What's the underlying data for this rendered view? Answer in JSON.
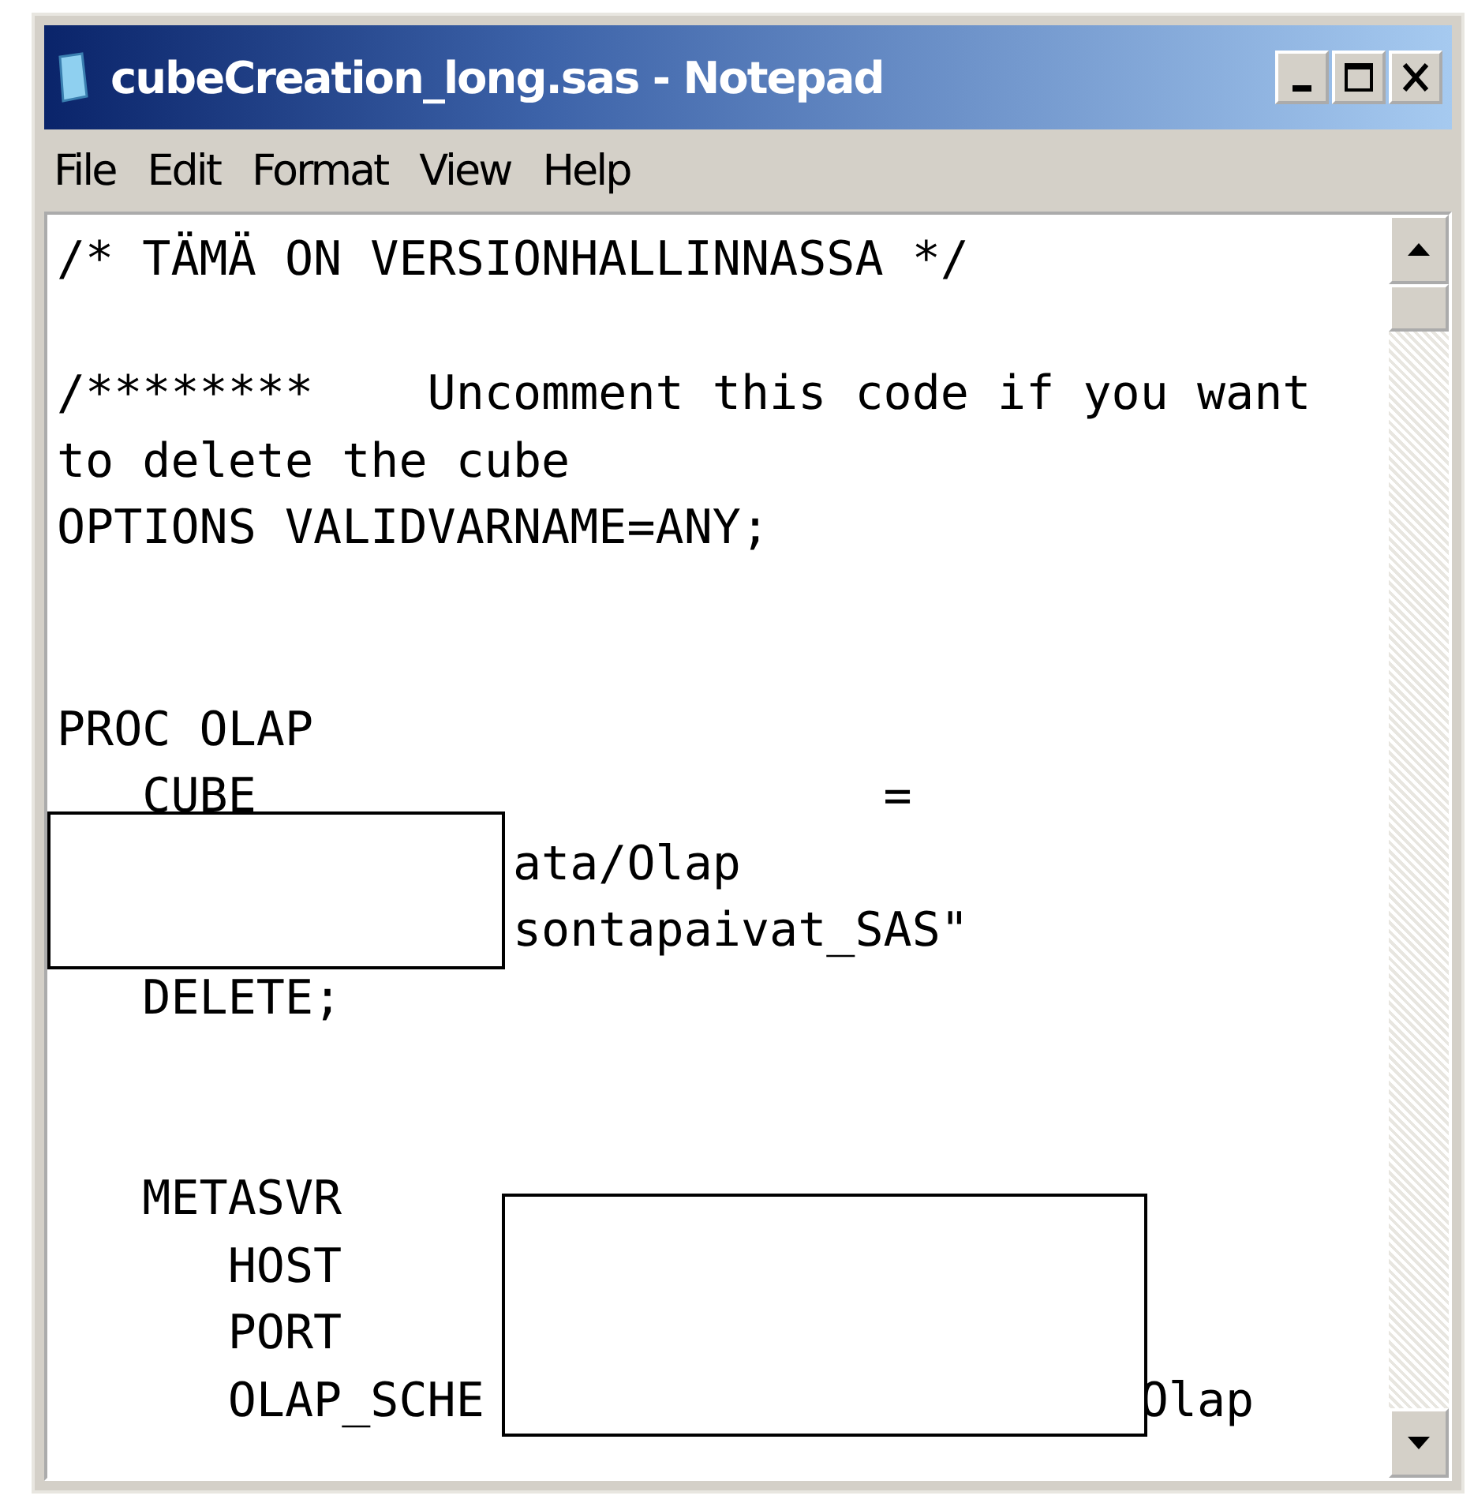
{
  "window": {
    "title": "cubeCreation_long.sas - Notepad"
  },
  "menu": [
    "File",
    "Edit",
    "Format",
    "View",
    "Help"
  ],
  "editor": {
    "lines": [
      {
        "kind": "code",
        "text": "/* TÄMÄ ON VERSIONHALLINNASSA */"
      },
      {
        "kind": "blank"
      },
      {
        "kind": "code",
        "text": "/********    Uncomment this code if you want"
      },
      {
        "kind": "code",
        "text": "to delete the cube"
      },
      {
        "kind": "code",
        "text": "OPTIONS VALIDVARNAME=ANY;"
      },
      {
        "kind": "blank"
      },
      {
        "kind": "blank"
      },
      {
        "kind": "code",
        "text": "PROC OLAP"
      },
      {
        "kind": "code",
        "text": "   CUBE                      ="
      },
      {
        "kind": "code",
        "text": "                ata/Olap"
      },
      {
        "kind": "code",
        "text": "                sontapaivat_SAS\""
      },
      {
        "kind": "code",
        "text": "   DELETE;"
      },
      {
        "kind": "blank"
      },
      {
        "kind": "blank"
      },
      {
        "kind": "code",
        "text": "   METASVR"
      },
      {
        "kind": "code",
        "text": "      HOST"
      },
      {
        "kind": "code",
        "text": "      PORT"
      },
      {
        "kind": "code",
        "text": "      OLAP_SCHE                       Olap"
      }
    ]
  }
}
